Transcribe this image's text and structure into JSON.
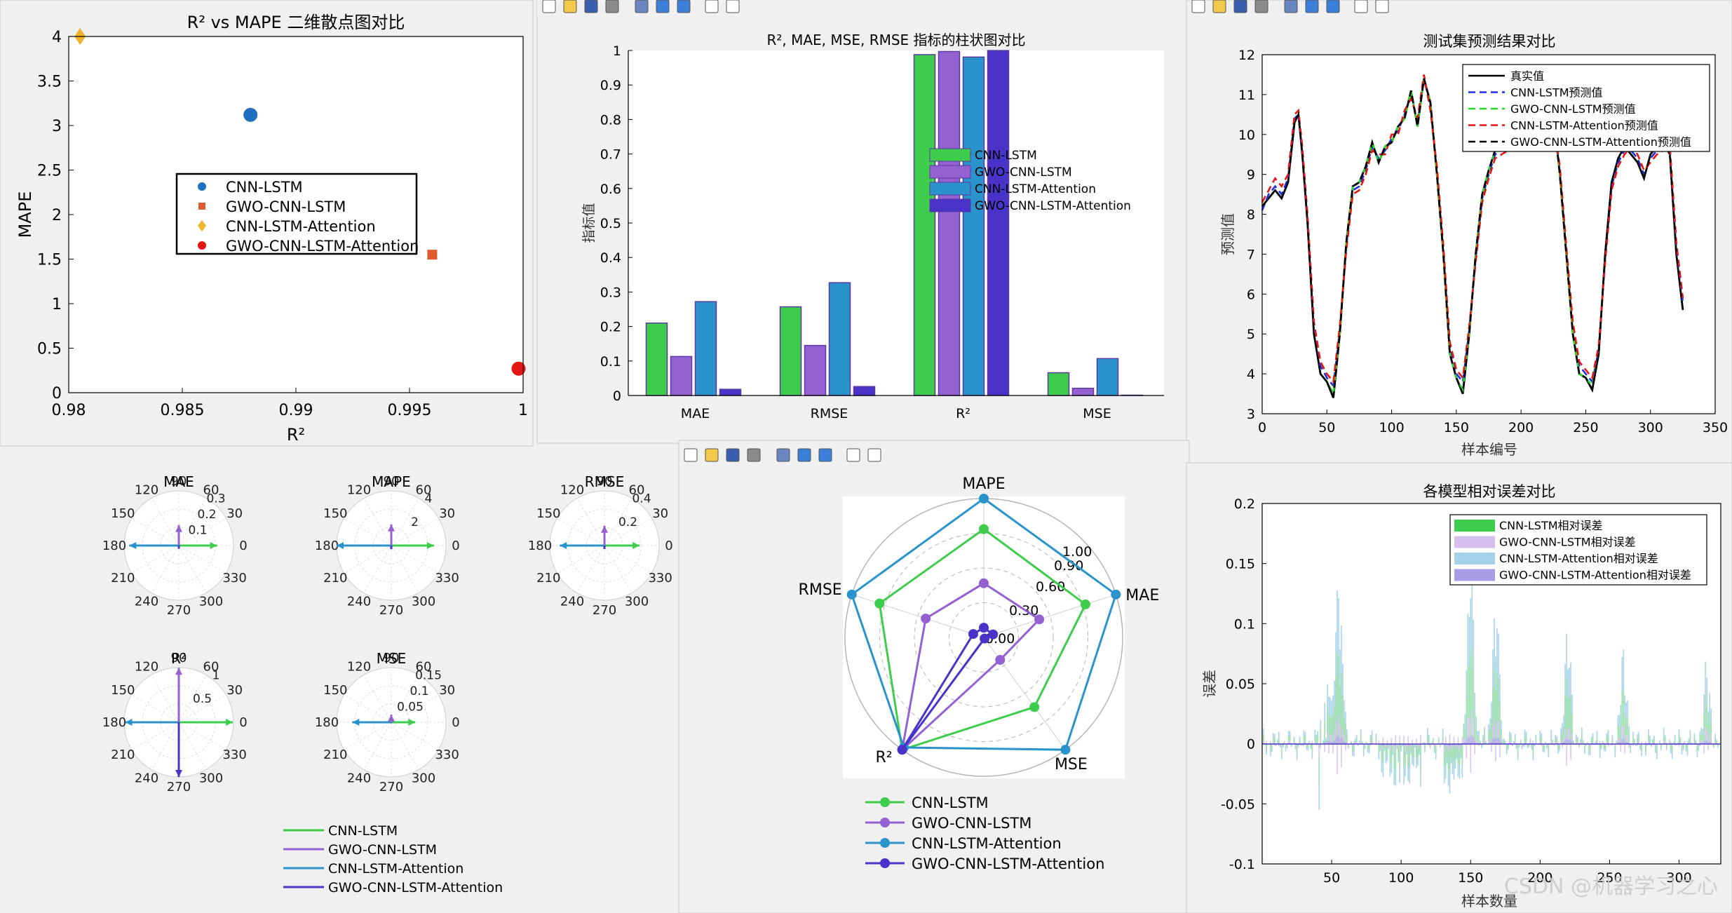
{
  "colors": {
    "cnn": "#3ECC4C",
    "gwo": "#9461D2",
    "att": "#2A93CC",
    "gwoatt": "#4A33C8",
    "bg": "#f0f0f0",
    "axes": "#ffffff",
    "frame": "#000000",
    "grid": "#b0b0b0"
  },
  "toolbar_icons": [
    "new-file-icon",
    "open-folder-icon",
    "save-icon",
    "print-icon",
    "print-preview-icon",
    "colorbar-icon",
    "legend-icon",
    "pointer-icon",
    "property-inspector-icon"
  ],
  "figures": {
    "scatter": {
      "title": "R² vs MAPE 二维散点图对比",
      "xlabel": "R²",
      "ylabel": "MAPE",
      "xticks": [
        "0.98",
        "0.985",
        "0.99",
        "0.995",
        "1"
      ],
      "yticks": [
        "0",
        "0.5",
        "1",
        "1.5",
        "2",
        "2.5",
        "3",
        "3.5",
        "4"
      ],
      "legend": [
        "CNN-LSTM",
        "GWO-CNN-LSTM",
        "CNN-LSTM-Attention",
        "GWO-CNN-LSTM-Attention"
      ]
    },
    "bar": {
      "title": "R², MAE, MSE, RMSE 指标的柱状图对比",
      "ylabel": "指标值",
      "categories": [
        "MAE",
        "RMSE",
        "R²",
        "MSE"
      ],
      "yticks": [
        "0",
        "0.1",
        "0.2",
        "0.3",
        "0.4",
        "0.5",
        "0.6",
        "0.7",
        "0.8",
        "0.9",
        "1"
      ],
      "legend": [
        "CNN-LSTM",
        "GWO-CNN-LSTM",
        "CNN-LSTM-Attention",
        "GWO-CNN-LSTM-Attention"
      ]
    },
    "line": {
      "title": "测试集预测结果对比",
      "xlabel": "样本编号",
      "ylabel": "预测值",
      "xticks": [
        "0",
        "50",
        "100",
        "150",
        "200",
        "250",
        "300",
        "350"
      ],
      "yticks": [
        "3",
        "4",
        "5",
        "6",
        "7",
        "8",
        "9",
        "10",
        "11",
        "12"
      ],
      "legend": [
        "真实值",
        "CNN-LSTM预测值",
        "GWO-CNN-LSTM预测值",
        "CNN-LSTM-Attention预测值",
        "GWO-CNN-LSTM-Attention预测值"
      ]
    },
    "compass": {
      "angle_labels": [
        "90",
        "60",
        "30",
        "0",
        "330",
        "300",
        "270",
        "240",
        "210",
        "180",
        "150",
        "120"
      ],
      "panels": [
        {
          "title": "MAE",
          "rlabels": [
            "0.1",
            "0.2",
            "0.3"
          ]
        },
        {
          "title": "MAPE",
          "rlabels": [
            "2",
            "4"
          ]
        },
        {
          "title": "RMSE",
          "rlabels": [
            "0.2",
            "0.4"
          ]
        },
        {
          "title": "R²",
          "rlabels": [
            "0.5",
            "1"
          ]
        },
        {
          "title": "MSE",
          "rlabels": [
            "0.05",
            "0.1",
            "0.15"
          ]
        }
      ],
      "legend": [
        "CNN-LSTM",
        "GWO-CNN-LSTM",
        "CNN-LSTM-Attention",
        "GWO-CNN-LSTM-Attention"
      ]
    },
    "radar": {
      "axes": [
        "MAPE",
        "MAE",
        "MSE",
        "R²",
        "RMSE"
      ],
      "rlabels": [
        "0.00",
        "0.30",
        "0.60",
        "0.90",
        "1.00"
      ],
      "legend": [
        "CNN-LSTM",
        "GWO-CNN-LSTM",
        "CNN-LSTM-Attention",
        "GWO-CNN-LSTM-Attention"
      ]
    },
    "error": {
      "title": "各模型相对误差对比",
      "xlabel": "样本数量",
      "ylabel": "误差",
      "xticks": [
        "50",
        "100",
        "150",
        "200",
        "250",
        "300"
      ],
      "yticks": [
        "0.2",
        "0.15",
        "0.1",
        "0.05",
        "0",
        "-0.05",
        "-0.1"
      ],
      "legend": [
        "CNN-LSTM相对误差",
        "GWO-CNN-LSTM相对误差",
        "CNN-LSTM-Attention相对误差",
        "GWO-CNN-LSTM-Attention相对误差"
      ]
    }
  },
  "watermark": "CSDN @机器学习之心",
  "chart_data": [
    {
      "type": "scatter",
      "title": "R² vs MAPE 二维散点图对比",
      "xlabel": "R²",
      "ylabel": "MAPE",
      "xlim": [
        0.98,
        1.0
      ],
      "ylim": [
        0,
        4
      ],
      "series": [
        {
          "name": "CNN-LSTM",
          "marker": "circle",
          "x": [
            0.988
          ],
          "y": [
            3.12
          ]
        },
        {
          "name": "GWO-CNN-LSTM",
          "marker": "square",
          "x": [
            0.996
          ],
          "y": [
            1.55
          ]
        },
        {
          "name": "CNN-LSTM-Attention",
          "marker": "diamond",
          "x": [
            0.9805
          ],
          "y": [
            4.0
          ]
        },
        {
          "name": "GWO-CNN-LSTM-Attention",
          "marker": "circle",
          "x": [
            0.9998
          ],
          "y": [
            0.27
          ]
        }
      ],
      "legend_position": "center-left",
      "grid": false
    },
    {
      "type": "bar",
      "title": "R², MAE, MSE, RMSE 指标的柱状图对比",
      "ylabel": "指标值",
      "ylim": [
        0,
        1
      ],
      "categories": [
        "MAE",
        "RMSE",
        "R²",
        "MSE"
      ],
      "series": [
        {
          "name": "CNN-LSTM",
          "values": [
            0.21,
            0.257,
            0.988,
            0.066
          ]
        },
        {
          "name": "GWO-CNN-LSTM",
          "values": [
            0.113,
            0.145,
            0.997,
            0.021
          ]
        },
        {
          "name": "CNN-LSTM-Attention",
          "values": [
            0.272,
            0.327,
            0.981,
            0.107
          ]
        },
        {
          "name": "GWO-CNN-LSTM-Attention",
          "values": [
            0.018,
            0.026,
            0.9998,
            0.001
          ]
        }
      ],
      "legend_position": "center-right",
      "grid": false
    },
    {
      "type": "line",
      "title": "测试集预测结果对比",
      "xlabel": "样本编号",
      "ylabel": "预测值",
      "xlim": [
        0,
        350
      ],
      "ylim": [
        3,
        12
      ],
      "x_keys": [
        0,
        5,
        10,
        15,
        20,
        25,
        28,
        31,
        35,
        40,
        45,
        50,
        55,
        60,
        65,
        70,
        75,
        80,
        85,
        90,
        95,
        100,
        105,
        110,
        115,
        120,
        125,
        130,
        135,
        140,
        145,
        150,
        155,
        160,
        165,
        170,
        175,
        180,
        190,
        200,
        210,
        220,
        225,
        230,
        235,
        240,
        245,
        250,
        255,
        260,
        265,
        270,
        275,
        280,
        285,
        290,
        295,
        300,
        305,
        310,
        315,
        320,
        325
      ],
      "series": [
        {
          "name": "真实值",
          "style": "solid",
          "values": [
            8.2,
            8.4,
            8.6,
            8.4,
            8.8,
            10.3,
            10.5,
            9.5,
            7.8,
            5.0,
            4.0,
            3.8,
            3.4,
            5.0,
            7.3,
            8.7,
            8.8,
            9.2,
            9.8,
            9.3,
            9.7,
            9.8,
            10.2,
            10.4,
            11.1,
            10.2,
            11.4,
            10.8,
            9.0,
            7.0,
            4.5,
            3.9,
            3.5,
            5.0,
            7.0,
            8.5,
            9.1,
            9.6,
            9.8,
            10.0,
            9.7,
            10.5,
            10.5,
            9.0,
            7.0,
            5.0,
            4.0,
            3.9,
            3.6,
            4.5,
            7.0,
            8.8,
            9.4,
            9.7,
            9.5,
            9.3,
            8.9,
            9.5,
            9.7,
            9.8,
            9.5,
            7.0,
            5.6
          ]
        },
        {
          "name": "CNN-LSTM预测值",
          "style": "dashed",
          "values": [
            8.1,
            8.5,
            8.7,
            8.5,
            8.9,
            10.4,
            10.5,
            9.6,
            7.9,
            5.2,
            4.2,
            3.9,
            3.7,
            5.1,
            7.2,
            8.6,
            8.7,
            9.1,
            9.7,
            9.4,
            9.6,
            9.9,
            10.1,
            10.5,
            11.0,
            10.3,
            11.4,
            10.7,
            9.1,
            7.1,
            4.7,
            4.0,
            3.8,
            5.1,
            6.9,
            8.4,
            9.0,
            9.5,
            9.7,
            9.9,
            9.8,
            10.4,
            10.4,
            9.1,
            7.1,
            5.2,
            4.2,
            4.0,
            3.8,
            4.6,
            6.9,
            8.7,
            9.3,
            9.6,
            9.6,
            9.4,
            9.0,
            9.4,
            9.6,
            9.7,
            9.6,
            7.2,
            5.8
          ]
        },
        {
          "name": "GWO-CNN-LSTM预测值",
          "style": "dashed",
          "values": [
            8.2,
            8.4,
            8.6,
            8.4,
            8.8,
            10.3,
            10.5,
            9.5,
            7.8,
            5.0,
            4.0,
            3.8,
            3.5,
            5.0,
            7.3,
            8.7,
            8.8,
            9.2,
            9.8,
            9.3,
            9.7,
            9.8,
            10.2,
            10.4,
            11.1,
            10.2,
            11.4,
            10.8,
            9.0,
            7.0,
            4.5,
            3.9,
            3.6,
            5.0,
            7.0,
            8.5,
            9.1,
            9.6,
            9.8,
            10.0,
            9.7,
            10.5,
            10.5,
            9.0,
            7.0,
            5.0,
            4.0,
            3.9,
            3.7,
            4.5,
            7.0,
            8.8,
            9.4,
            9.7,
            9.5,
            9.3,
            8.9,
            9.5,
            9.7,
            9.8,
            9.5,
            7.0,
            5.6
          ]
        },
        {
          "name": "CNN-LSTM-Attention预测值",
          "style": "dashed",
          "values": [
            8.3,
            8.6,
            8.9,
            8.7,
            9.0,
            10.5,
            10.6,
            9.7,
            8.0,
            5.3,
            4.3,
            4.0,
            3.8,
            5.2,
            7.1,
            8.5,
            8.6,
            9.0,
            9.6,
            9.5,
            9.5,
            10.0,
            10.0,
            10.6,
            10.9,
            10.4,
            11.5,
            10.6,
            9.2,
            7.2,
            4.8,
            4.1,
            3.9,
            5.2,
            6.8,
            8.3,
            8.9,
            9.4,
            9.6,
            9.8,
            9.9,
            10.3,
            10.3,
            9.2,
            7.2,
            5.3,
            4.3,
            4.1,
            3.9,
            4.7,
            6.8,
            8.6,
            9.2,
            9.5,
            9.7,
            9.5,
            9.1,
            9.3,
            9.5,
            9.6,
            9.7,
            7.3,
            5.9
          ]
        },
        {
          "name": "GWO-CNN-LSTM-Attention预测值",
          "style": "dashed",
          "values": [
            8.2,
            8.4,
            8.6,
            8.4,
            8.8,
            10.3,
            10.5,
            9.5,
            7.8,
            5.0,
            4.0,
            3.8,
            3.4,
            5.0,
            7.3,
            8.7,
            8.8,
            9.2,
            9.8,
            9.3,
            9.7,
            9.8,
            10.2,
            10.4,
            11.1,
            10.2,
            11.4,
            10.8,
            9.0,
            7.0,
            4.5,
            3.9,
            3.5,
            5.0,
            7.0,
            8.5,
            9.1,
            9.6,
            9.8,
            10.0,
            9.7,
            10.5,
            10.5,
            9.0,
            7.0,
            5.0,
            4.0,
            3.9,
            3.6,
            4.5,
            7.0,
            8.8,
            9.4,
            9.7,
            9.5,
            9.3,
            8.9,
            9.5,
            9.7,
            9.8,
            9.5,
            7.0,
            5.6
          ]
        }
      ],
      "legend_position": "top-right",
      "grid": false
    },
    {
      "type": "compass",
      "panels": [
        {
          "title": "MAE",
          "rmax": 0.3,
          "values": {
            "CNN-LSTM": 0.21,
            "GWO-CNN-LSTM": 0.113,
            "CNN-LSTM-Attention": 0.272,
            "GWO-CNN-LSTM-Attention": 0.018
          }
        },
        {
          "title": "MAPE",
          "rmax": 4,
          "values": {
            "CNN-LSTM": 3.12,
            "GWO-CNN-LSTM": 1.55,
            "CNN-LSTM-Attention": 4.0,
            "GWO-CNN-LSTM-Attention": 0.27
          }
        },
        {
          "title": "RMSE",
          "rmax": 0.4,
          "values": {
            "CNN-LSTM": 0.257,
            "GWO-CNN-LSTM": 0.145,
            "CNN-LSTM-Attention": 0.327,
            "GWO-CNN-LSTM-Attention": 0.026
          }
        },
        {
          "title": "R²",
          "rmax": 1,
          "values": {
            "CNN-LSTM": 0.988,
            "GWO-CNN-LSTM": 0.997,
            "CNN-LSTM-Attention": 0.981,
            "GWO-CNN-LSTM-Attention": 0.9998
          }
        },
        {
          "title": "MSE",
          "rmax": 0.15,
          "values": {
            "CNN-LSTM": 0.066,
            "GWO-CNN-LSTM": 0.021,
            "CNN-LSTM-Attention": 0.107,
            "GWO-CNN-LSTM-Attention": 0.001
          }
        }
      ],
      "directions_deg": {
        "CNN-LSTM": 0,
        "GWO-CNN-LSTM": 90,
        "CNN-LSTM-Attention": 180,
        "GWO-CNN-LSTM-Attention": 270
      }
    },
    {
      "type": "radar",
      "axes": [
        "MAPE",
        "MAE",
        "MSE",
        "R²",
        "RMSE"
      ],
      "rlim": [
        0,
        1
      ],
      "series": [
        {
          "name": "CNN-LSTM",
          "values": [
            0.78,
            0.77,
            0.62,
            1.0,
            0.79
          ]
        },
        {
          "name": "GWO-CNN-LSTM",
          "values": [
            0.39,
            0.42,
            0.2,
            1.0,
            0.44
          ]
        },
        {
          "name": "CNN-LSTM-Attention",
          "values": [
            1.0,
            1.0,
            1.0,
            0.98,
            1.0
          ]
        },
        {
          "name": "GWO-CNN-LSTM-Attention",
          "values": [
            0.07,
            0.07,
            0.01,
            1.0,
            0.08
          ]
        }
      ],
      "legend_position": "bottom"
    },
    {
      "type": "bar",
      "subtype": "error-bars-dense",
      "title": "各模型相对误差对比",
      "xlabel": "样本数量",
      "ylabel": "误差",
      "xlim": [
        0,
        330
      ],
      "ylim": [
        -0.1,
        0.2
      ],
      "series": [
        {
          "name": "CNN-LSTM相对误差",
          "peak_positive": 0.15,
          "peak_negative": -0.05
        },
        {
          "name": "GWO-CNN-LSTM相对误差",
          "peak_positive": 0.03,
          "peak_negative": -0.03
        },
        {
          "name": "CNN-LSTM-Attention相对误差",
          "peak_positive": 0.15,
          "peak_negative": -0.09
        },
        {
          "name": "GWO-CNN-LSTM-Attention相对误差",
          "peak_positive": 0.005,
          "peak_negative": -0.005
        }
      ],
      "legend_position": "top-right"
    }
  ]
}
